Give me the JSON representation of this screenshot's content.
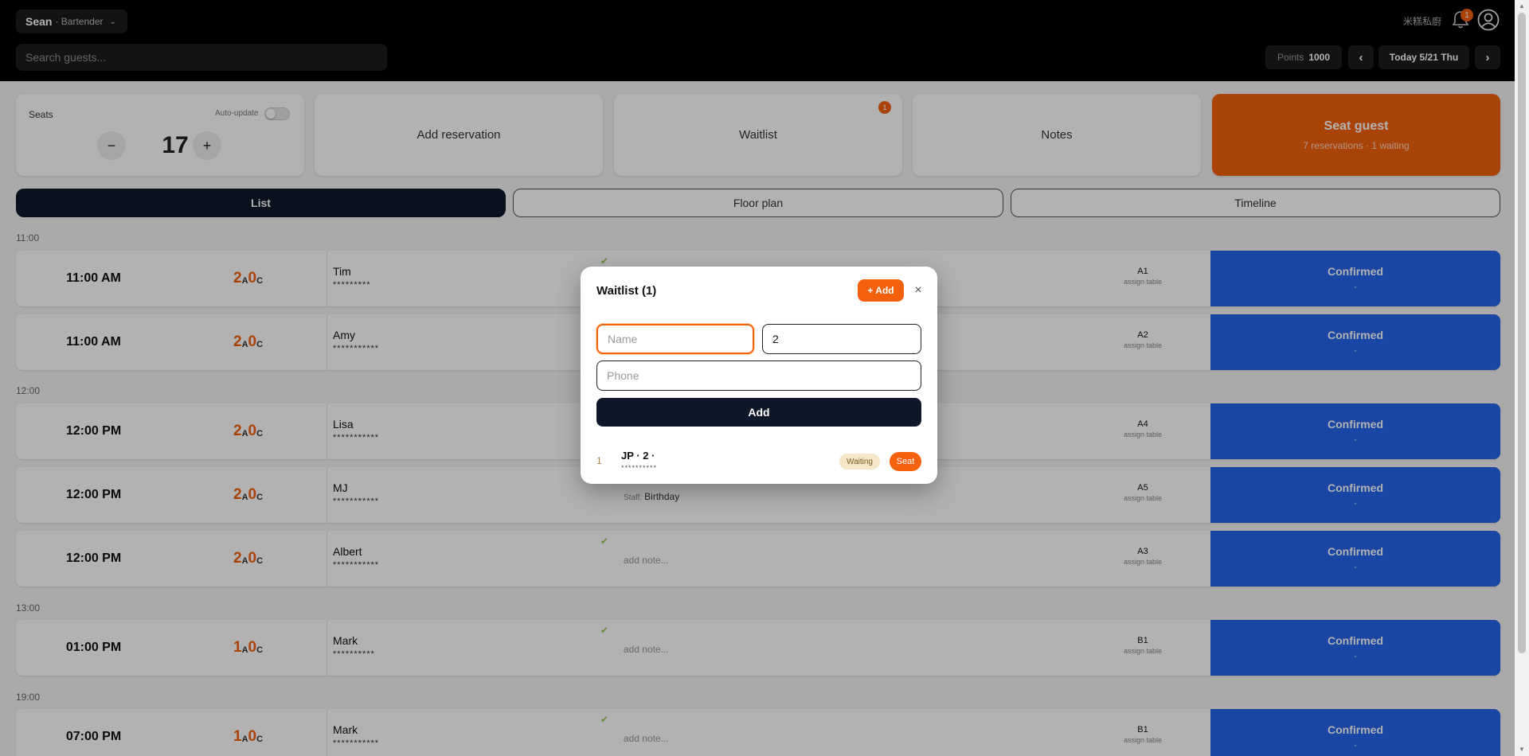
{
  "header": {
    "user_name": "Sean",
    "user_role": "· Bartender",
    "search_placeholder": "Search guests...",
    "restaurant_name": "米糕私廚",
    "notification_count": "1",
    "points_label": "Points",
    "points_value": "1000",
    "date_label": "Today 5/21 Thu",
    "prev_arrow": "‹",
    "next_arrow": "›"
  },
  "seats_card": {
    "title": "Seats",
    "auto_update_label": "Auto-update",
    "auto_update_on": false,
    "minus": "−",
    "plus": "+",
    "count": "17"
  },
  "cards": {
    "add_reservation": "Add reservation",
    "waitlist": "Waitlist",
    "waitlist_badge": "1",
    "notes": "Notes",
    "seat_guest_title": "Seat guest",
    "seat_guest_sub": "7 reservations · 1 waiting"
  },
  "tabs": [
    "List",
    "Floor plan",
    "Timeline"
  ],
  "groups": [
    "11:00",
    "12:00",
    "13:00",
    "19:00"
  ],
  "reservations": [
    {
      "time": "11:00 AM",
      "adults": "2",
      "adult_unit": "A",
      "children": "0",
      "child_unit": "C",
      "name": "Tim",
      "phone": "*********",
      "check": "✔",
      "note": "",
      "staff_label": "",
      "table": "A1",
      "assign": "assign table",
      "status": "Confirmed",
      "status_detail": "-"
    },
    {
      "time": "11:00 AM",
      "adults": "2",
      "adult_unit": "A",
      "children": "0",
      "child_unit": "C",
      "name": "Amy",
      "phone": "***********",
      "check": "",
      "note": "",
      "staff_label": "",
      "table": "A2",
      "assign": "assign table",
      "status": "Confirmed",
      "status_detail": "-"
    },
    {
      "time": "12:00 PM",
      "adults": "2",
      "adult_unit": "A",
      "children": "0",
      "child_unit": "C",
      "name": "Lisa",
      "phone": "***********",
      "check": "",
      "note": "",
      "staff_label": "",
      "table": "A4",
      "assign": "assign table",
      "status": "Confirmed",
      "status_detail": "-"
    },
    {
      "time": "12:00 PM",
      "adults": "2",
      "adult_unit": "A",
      "children": "0",
      "child_unit": "C",
      "name": "MJ",
      "phone": "***********",
      "check": "",
      "note": "Birthday",
      "staff_label": "Staff:",
      "table": "A5",
      "assign": "assign table",
      "status": "Confirmed",
      "status_detail": "-"
    },
    {
      "time": "12:00 PM",
      "adults": "2",
      "adult_unit": "A",
      "children": "0",
      "child_unit": "C",
      "name": "Albert",
      "phone": "***********",
      "check": "✔",
      "note": "add note...",
      "staff_label": "",
      "table": "A3",
      "assign": "assign table",
      "status": "Confirmed",
      "status_detail": "-"
    },
    {
      "time": "01:00 PM",
      "adults": "1",
      "adult_unit": "A",
      "children": "0",
      "child_unit": "C",
      "name": "Mark",
      "phone": "**********",
      "check": "✔",
      "note": "add note...",
      "staff_label": "",
      "table": "B1",
      "assign": "assign table",
      "status": "Confirmed",
      "status_detail": "-"
    },
    {
      "time": "07:00 PM",
      "adults": "1",
      "adult_unit": "A",
      "children": "0",
      "child_unit": "C",
      "name": "Mark",
      "phone": "***********",
      "check": "✔",
      "note": "add note...",
      "staff_label": "",
      "table": "B1",
      "assign": "assign table",
      "status": "Confirmed",
      "status_detail": "-"
    }
  ],
  "modal": {
    "title": "Waitlist (1)",
    "add_button": "+ Add",
    "close": "×",
    "name_placeholder": "Name",
    "name_value": "",
    "party_value": "2",
    "phone_placeholder": "Phone",
    "phone_value": "",
    "submit": "Add",
    "entries": [
      {
        "index": "1",
        "label": "JP · 2 ·",
        "phone": "**********",
        "status": "Waiting",
        "action": "Seat"
      }
    ]
  },
  "colors": {
    "accent": "#f4600c",
    "dark": "#0f172a",
    "confirmed": "#2563eb",
    "header_bg": "#000000"
  }
}
